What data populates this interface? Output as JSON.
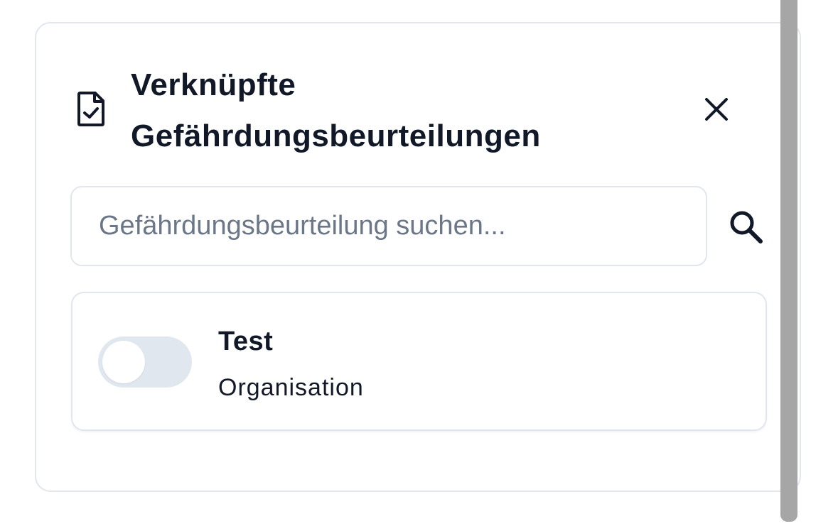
{
  "dialog": {
    "title_line1": "Verknüpfte",
    "title_line2": "Gefährdungsbeurteilungen",
    "header_icon": "file-check-icon",
    "close_icon": "close-icon"
  },
  "search": {
    "placeholder": "Gefährdungsbeurteilung suchen...",
    "value": "",
    "icon": "search-icon"
  },
  "items": [
    {
      "title": "Test",
      "subtitle": "Organisation",
      "linked": false
    }
  ],
  "colors": {
    "text": "#111827",
    "placeholder": "#6b7789",
    "border": "#e2e6ee",
    "toggle_off": "#e1e7ef",
    "scrollbar": "#a6a6a6"
  }
}
